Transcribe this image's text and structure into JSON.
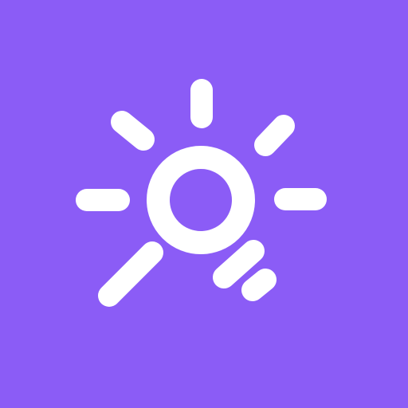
{
  "icon": {
    "name": "sun-brightness-icon",
    "background_color": "#8b5cf6",
    "foreground_color": "#ffffff"
  }
}
